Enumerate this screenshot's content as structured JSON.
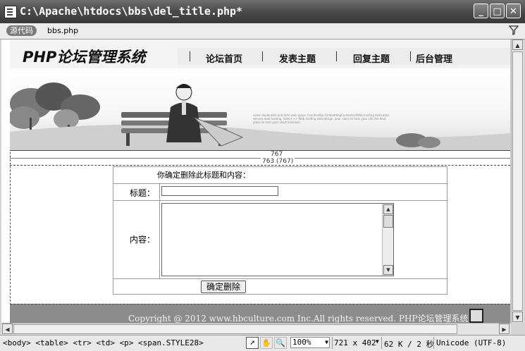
{
  "window": {
    "title": "C:\\Apache\\htdocs\\bbs\\del_title.php*",
    "buttons": {
      "minimize": "_",
      "maximize": "□",
      "close": "✕"
    }
  },
  "toolbar": {
    "source_label": "源代码",
    "file_tab": "bbs.php"
  },
  "page": {
    "logo": "PHP论坛管理系统",
    "nav": [
      "论坛首页",
      "发表主题",
      "回复主题",
      "后台管理"
    ],
    "banner_text": "some deplorable and hide web space. FunctionBar EmbeddingContentsofWeb hosting dedicated servers web hosting. Select >> Web hosting web design. your voice to host your site the best place to host your short business.",
    "ruler_1": "767",
    "ruler_2": "763 (767)",
    "form": {
      "confirm_text": "你确定删除此标题和内容：",
      "title_label": "标题：",
      "content_label": "内容：",
      "title_value": "",
      "content_value": "",
      "submit_label": "确定删除"
    },
    "footer": "Copyright @ 2012 www.hbculture.com Inc.All rights reserved. PHP论坛管理系统"
  },
  "statusbar": {
    "tag_path": "<body> <table> <tr> <td> <p> <span.STYLE28>",
    "zoom": "100%",
    "dimensions": "721 x 402",
    "size_time": "62 K / 2 秒",
    "encoding": "Unicode (UTF-8)"
  }
}
